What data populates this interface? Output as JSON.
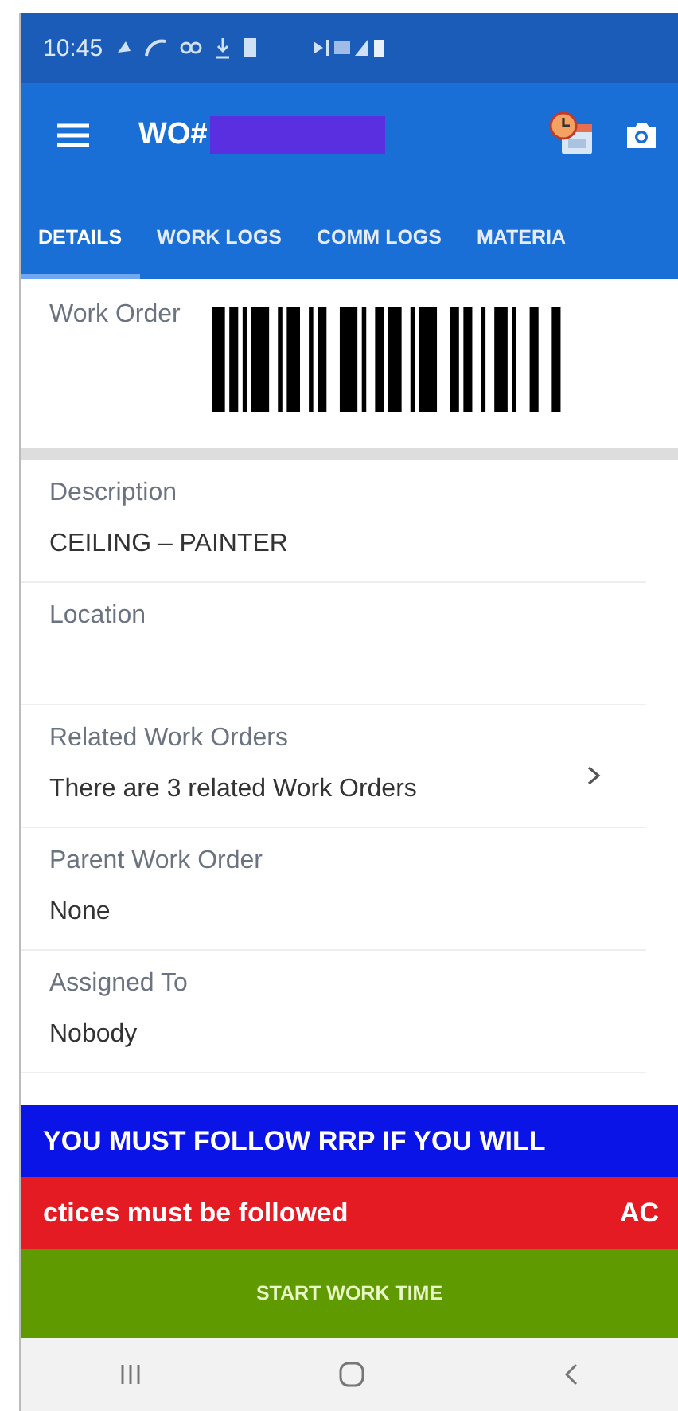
{
  "status_bar": {
    "time": "10:45"
  },
  "app_bar": {
    "title": "WO#",
    "title_redacted": true
  },
  "tabs": [
    {
      "label": "DETAILS",
      "selected": true
    },
    {
      "label": "WORK LOGS",
      "selected": false
    },
    {
      "label": "COMM LOGS",
      "selected": false
    },
    {
      "label": "MATERIA",
      "selected": false
    }
  ],
  "work_order": {
    "label": "Work Order"
  },
  "fields": [
    {
      "label": "Description",
      "value": "CEILING – PAINTER",
      "kind": "plain"
    },
    {
      "label": "Location",
      "kind": "plain"
    },
    {
      "label": "Related Work Orders",
      "value": "There are 3 related Work Orders",
      "kind": "link"
    },
    {
      "label": "Parent Work Order",
      "value": "None",
      "kind": "plain"
    },
    {
      "label": "Assigned To",
      "value": "Nobody",
      "kind": "plain"
    }
  ],
  "banners": [
    {
      "texts": [
        "YOU MUST FOLLOW RRP IF YOU WILL"
      ],
      "color": "#0a14e6"
    },
    {
      "texts": [
        "ctices must be followed",
        "AC"
      ],
      "color": "#e51b24"
    }
  ],
  "action_button": {
    "label": "START WORK TIME"
  }
}
